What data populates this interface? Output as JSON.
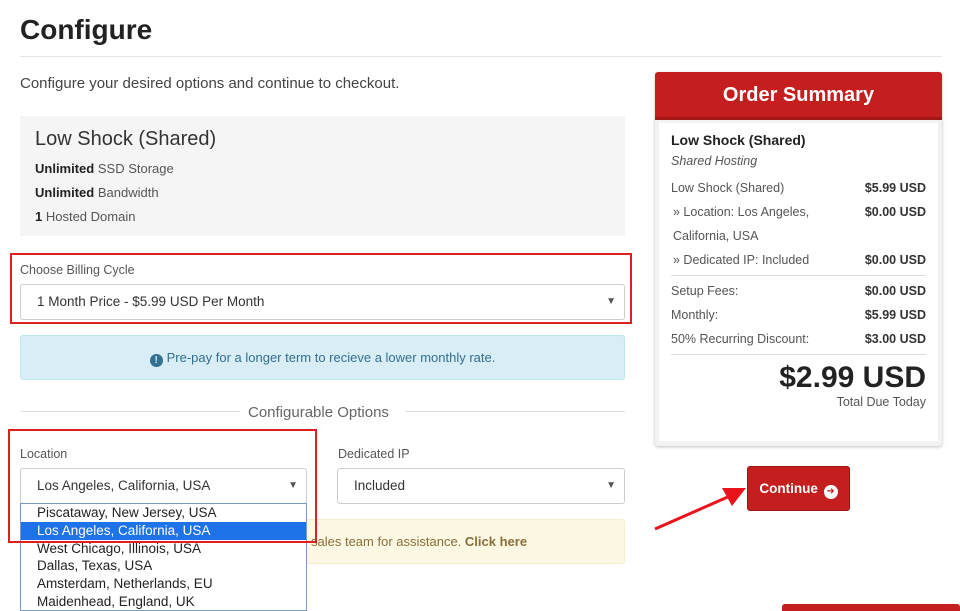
{
  "page": {
    "title": "Configure",
    "intro": "Configure your desired options and continue to checkout."
  },
  "product": {
    "name": "Low Shock (Shared)",
    "features": [
      {
        "bold": "Unlimited",
        "text": " SSD Storage"
      },
      {
        "bold": "Unlimited",
        "text": " Bandwidth"
      },
      {
        "bold": "1",
        "text": " Hosted Domain"
      }
    ]
  },
  "billing": {
    "label": "Choose Billing Cycle",
    "selected": "1 Month Price - $5.99 USD Per Month"
  },
  "info": {
    "text": "Pre-pay for a longer term to recieve a lower monthly rate."
  },
  "configurable": {
    "heading": "Configurable Options",
    "location_label": "Location",
    "location_selected": "Los Angeles, California, USA",
    "location_options": [
      "Piscataway, New Jersey, USA",
      "Los Angeles, California, USA",
      "West Chicago, Illinois, USA",
      "Dallas, Texas, USA",
      "Amsterdam, Netherlands, EU",
      "Maidenhead, England, UK"
    ],
    "location_highlighted_index": 1,
    "dedicated_ip_label": "Dedicated IP",
    "dedicated_ip_selected": "Included"
  },
  "warning": {
    "text": "sales team for assistance. ",
    "link": "Click here"
  },
  "summary": {
    "header": "Order Summary",
    "product": "Low Shock (Shared)",
    "group": "Shared Hosting",
    "lines": [
      {
        "label": "Low Shock (Shared)",
        "amount": "$5.99 USD"
      },
      {
        "label": "» Location: Los Angeles, California, USA",
        "amount": "$0.00 USD"
      },
      {
        "label": "» Dedicated IP: Included",
        "amount": "$0.00 USD"
      }
    ],
    "fees": [
      {
        "label": "Setup Fees:",
        "amount": "$0.00 USD"
      },
      {
        "label": "Monthly:",
        "amount": "$5.99 USD"
      },
      {
        "label": "50% Recurring Discount:",
        "amount": "$3.00 USD"
      }
    ],
    "total": "$2.99 USD",
    "total_label": "Total Due Today"
  },
  "continue": {
    "label": "Continue"
  },
  "colors": {
    "brand_red": "#c41e1e",
    "info_bg": "#d9edf7",
    "warn_bg": "#fcf8e3",
    "select_highlight": "#1e73e8",
    "annotation_red": "#e02020"
  },
  "icons": {
    "info": "info-circle-icon",
    "select_arrow": "caret-down-icon",
    "continue": "arrow-circle-right-icon",
    "annotation": "red-arrow-pointer"
  }
}
